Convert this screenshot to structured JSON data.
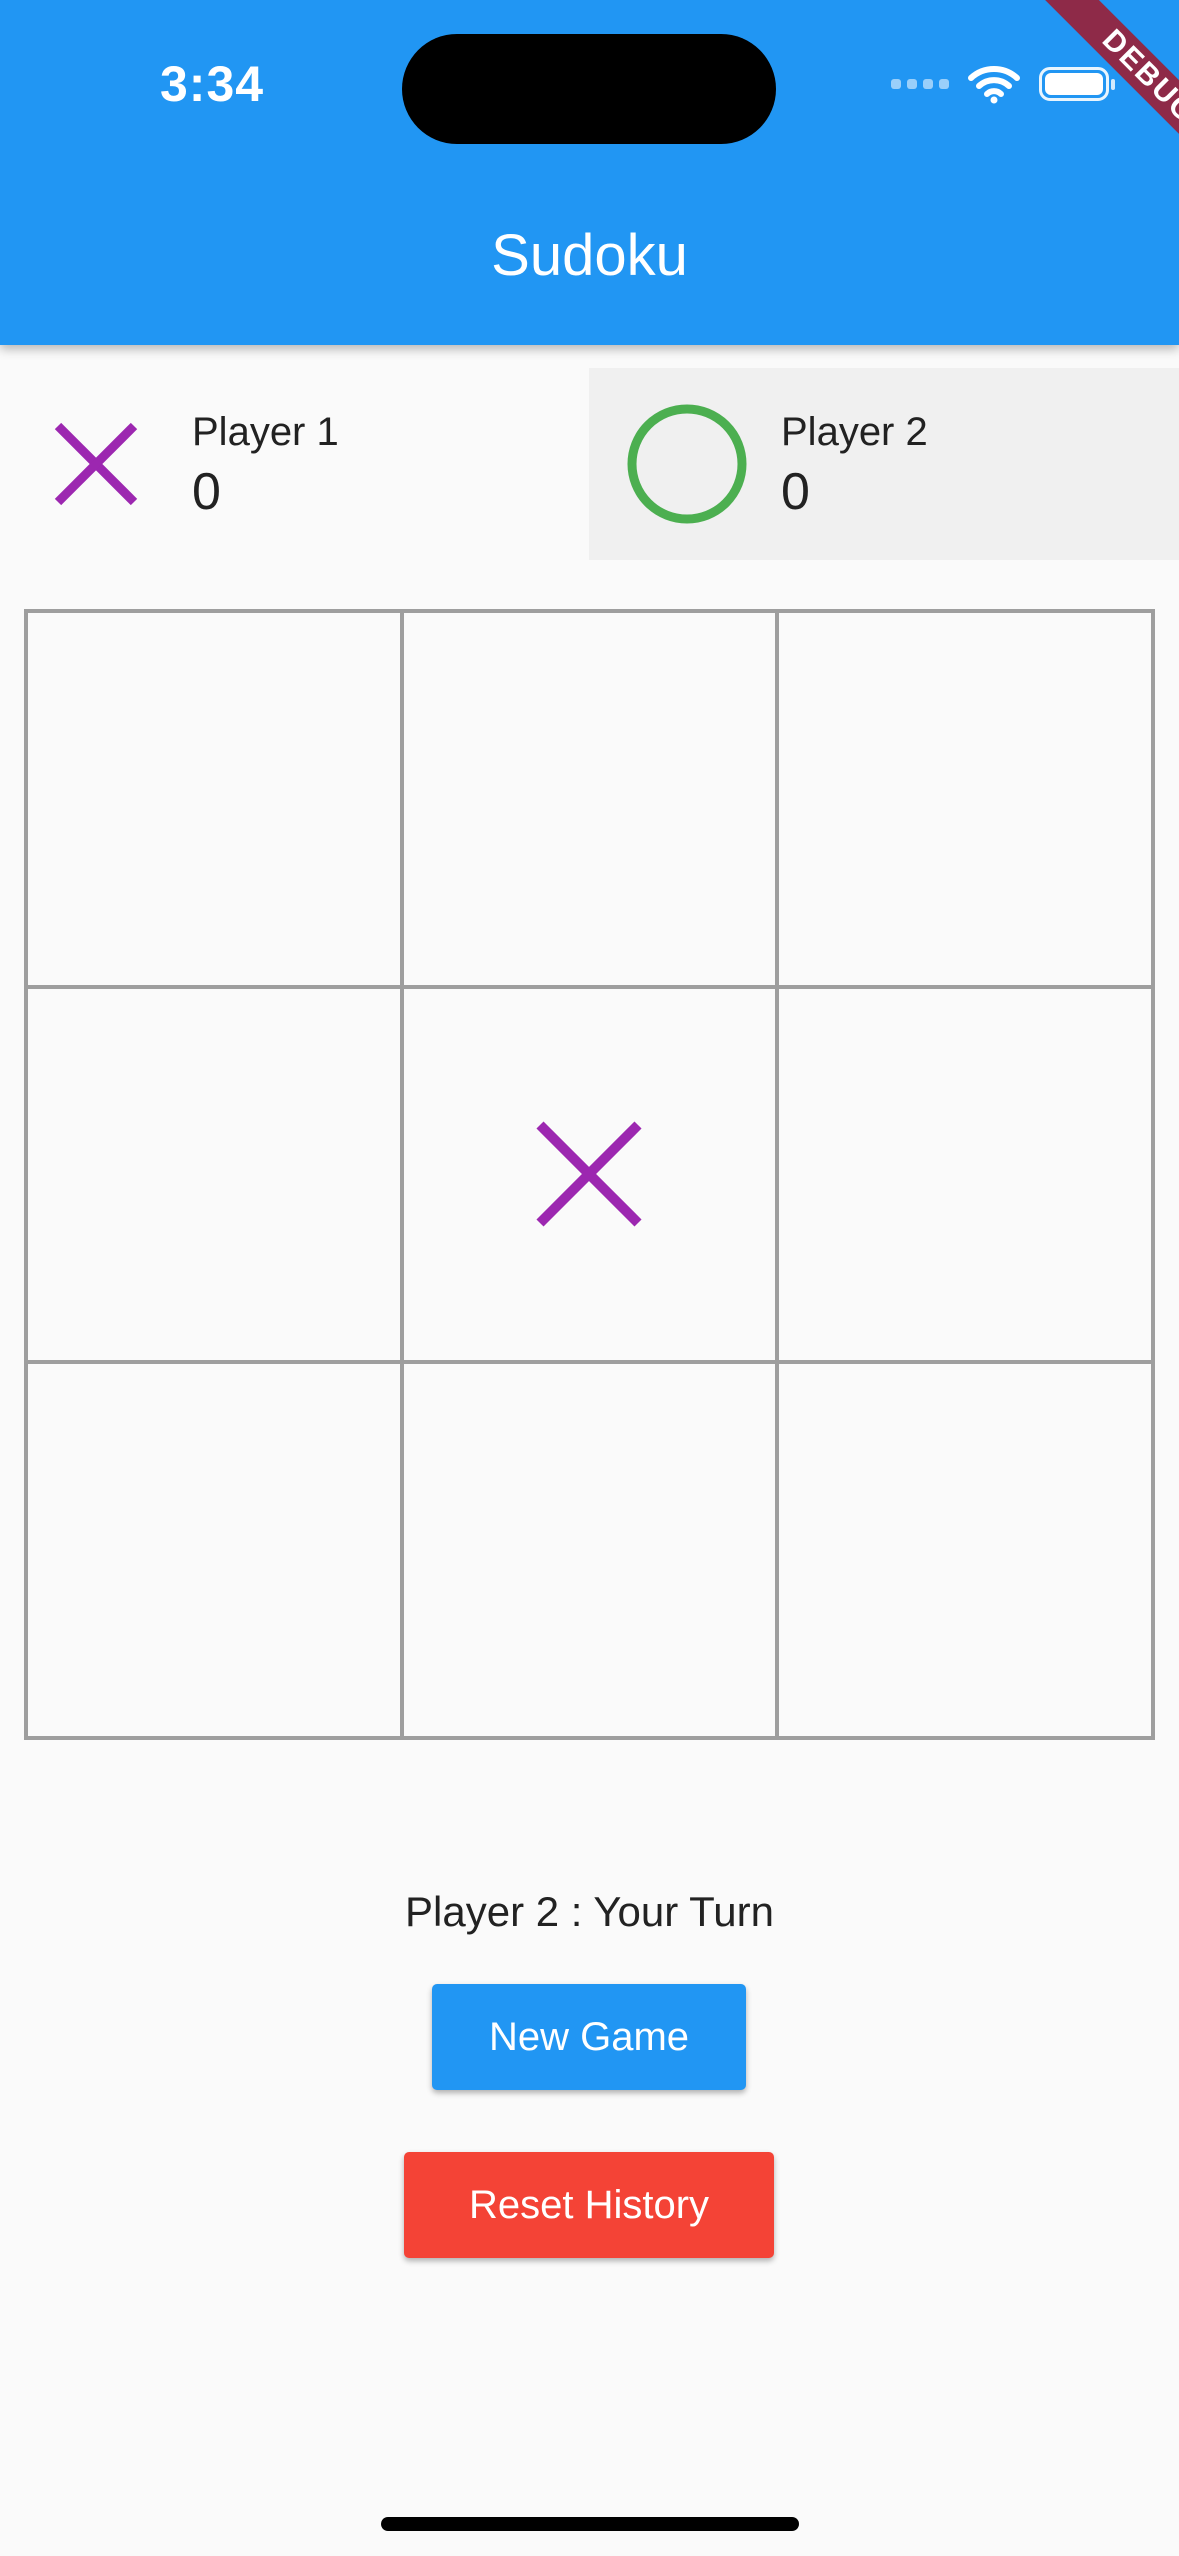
{
  "status_bar": {
    "time": "3:34"
  },
  "app_bar": {
    "title": "Sudoku",
    "debug_banner": "DEBUG",
    "color": "#2196f3"
  },
  "players": [
    {
      "name": "Player 1",
      "score": "0",
      "symbol": "x",
      "color": "#9c27b0",
      "active": false
    },
    {
      "name": "Player 2",
      "score": "0",
      "symbol": "o",
      "color": "#4caf50",
      "active": true
    }
  ],
  "board": {
    "cells": [
      "",
      "",
      "",
      "",
      "X",
      "",
      "",
      "",
      ""
    ],
    "x_color": "#9c27b0",
    "o_color": "#4caf50"
  },
  "status_message": "Player 2 : Your Turn",
  "buttons": {
    "new_game": "New Game",
    "reset_history": "Reset History"
  },
  "colors": {
    "new_game": "#2196f3",
    "reset_history": "#f44336"
  }
}
